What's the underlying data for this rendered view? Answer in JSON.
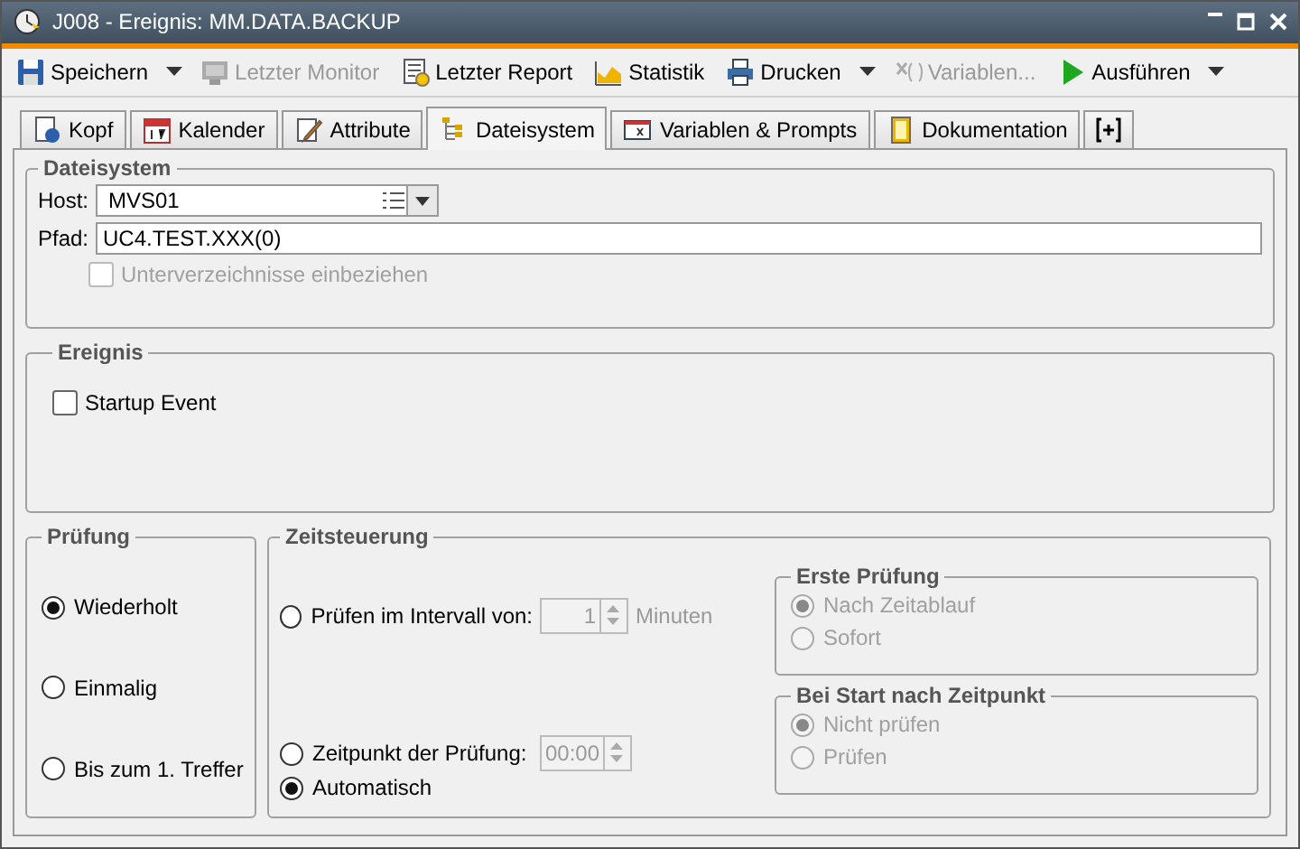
{
  "window": {
    "title": "J008 - Ereignis: MM.DATA.BACKUP"
  },
  "toolbar": [
    {
      "label": "Speichern",
      "disabled": false,
      "has_menu": true
    },
    {
      "label": "Letzter Monitor",
      "disabled": true,
      "has_menu": false
    },
    {
      "label": "Letzter Report",
      "disabled": false,
      "has_menu": false
    },
    {
      "label": "Statistik",
      "disabled": false,
      "has_menu": false
    },
    {
      "label": "Drucken",
      "disabled": false,
      "has_menu": true
    },
    {
      "label": "Variablen...",
      "disabled": true,
      "has_menu": false
    },
    {
      "label": "Ausführen",
      "disabled": false,
      "has_menu": true
    }
  ],
  "tabs": [
    {
      "label": "Kopf",
      "selected": false
    },
    {
      "label": "Kalender",
      "selected": false
    },
    {
      "label": "Attribute",
      "selected": false
    },
    {
      "label": "Dateisystem",
      "selected": true
    },
    {
      "label": "Variablen & Prompts",
      "selected": false
    },
    {
      "label": "Dokumentation",
      "selected": false
    }
  ],
  "dateisystem": {
    "title": "Dateisystem",
    "host": {
      "label": "Host:",
      "value": "MVS01"
    },
    "pfad": {
      "label": "Pfad:",
      "value": "UC4.TEST.XXX(0)"
    },
    "subdirs": {
      "label": "Unterverzeichnisse einbeziehen",
      "checked": false,
      "disabled": true
    }
  },
  "ereignis": {
    "title": "Ereignis",
    "startup": {
      "label": "Startup Event",
      "checked": false
    }
  },
  "pruefung": {
    "title": "Prüfung",
    "options": [
      {
        "label": "Wiederholt",
        "selected": true
      },
      {
        "label": "Einmalig",
        "selected": false
      },
      {
        "label": "Bis zum 1. Treffer",
        "selected": false
      }
    ]
  },
  "zeitsteuerung": {
    "title": "Zeitsteuerung",
    "options": [
      {
        "kind": "interval",
        "label": "Prüfen im Intervall von:",
        "selected": false,
        "value": "1",
        "unit": "Minuten",
        "disabled": true
      },
      {
        "kind": "time",
        "label": "Zeitpunkt der Prüfung:",
        "selected": false,
        "value": "00:00",
        "disabled": true
      },
      {
        "kind": "plain",
        "label": "Automatisch",
        "selected": true
      }
    ],
    "erste_pruefung": {
      "title": "Erste Prüfung",
      "disabled": true,
      "options": [
        {
          "label": "Nach Zeitablauf",
          "selected": true
        },
        {
          "label": "Sofort",
          "selected": false
        }
      ]
    },
    "bei_start": {
      "title": "Bei Start nach Zeitpunkt",
      "disabled": true,
      "options": [
        {
          "label": "Nicht prüfen",
          "selected": true
        },
        {
          "label": "Prüfen",
          "selected": false
        }
      ]
    }
  }
}
